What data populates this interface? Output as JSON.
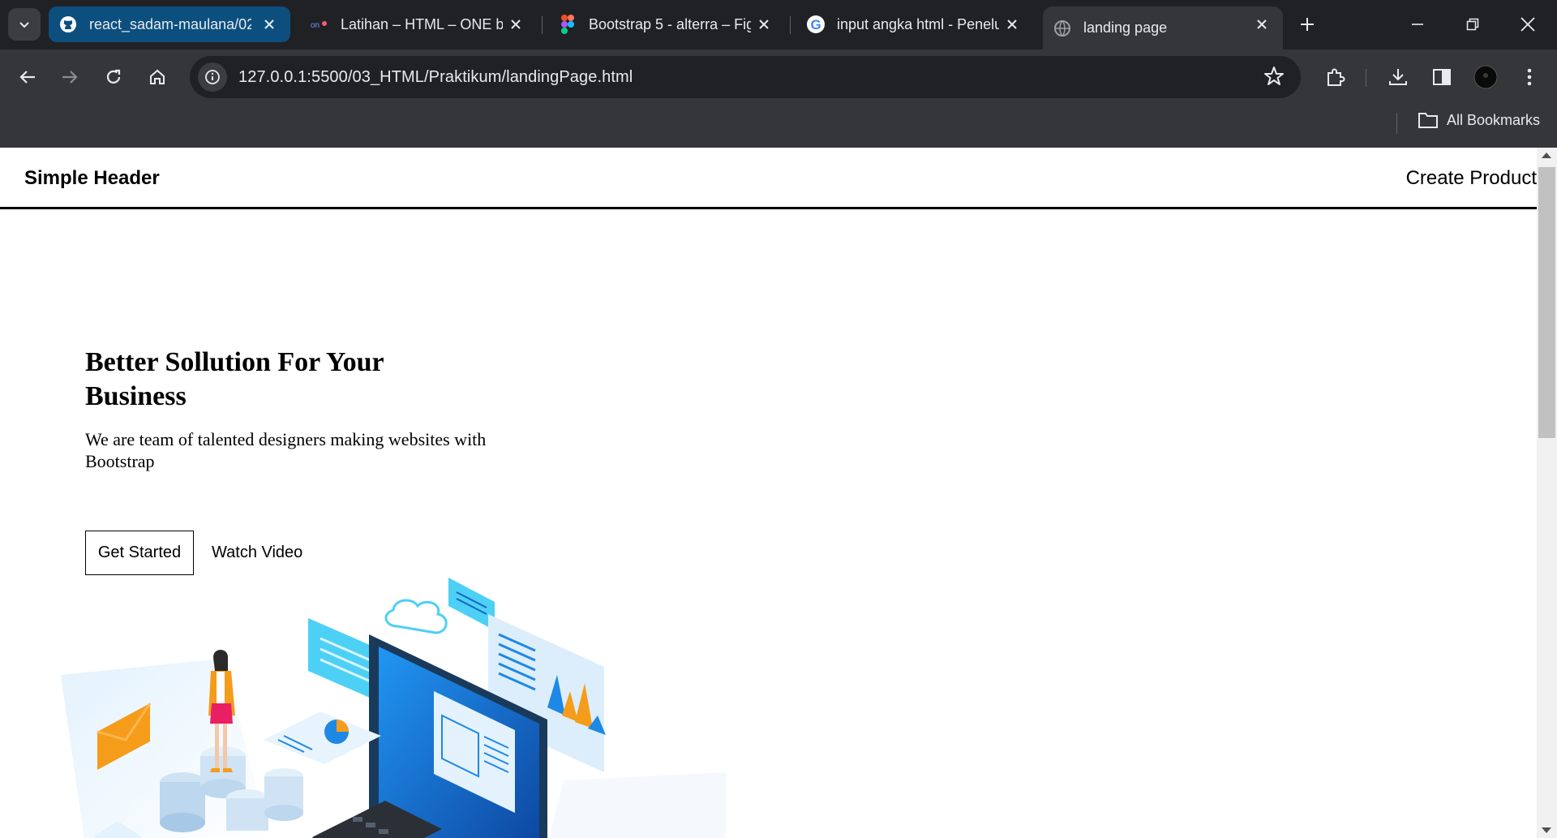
{
  "browser": {
    "tabs": [
      {
        "title": "react_sadam-maulana/02",
        "favicon": "github-icon"
      },
      {
        "title": "Latihan – HTML – ONE by",
        "favicon": "one-logo-icon"
      },
      {
        "title": "Bootstrap 5 - alterra – Fig",
        "favicon": "figma-icon"
      },
      {
        "title": "input angka html - Penelu",
        "favicon": "google-icon"
      },
      {
        "title": "landing page",
        "favicon": "globe-icon"
      }
    ],
    "url": "127.0.0.1:5500/03_HTML/Praktikum/landingPage.html",
    "bookmarks_label": "All Bookmarks"
  },
  "site": {
    "header": {
      "brand": "Simple Header",
      "nav_link": "Create Product"
    },
    "hero": {
      "title": "Better Sollution For Your Business",
      "subtitle": "We are team of talented designers making websites with Bootstrap",
      "primary_button": "Get Started",
      "secondary_link": "Watch Video",
      "illustration": "isometric-business-illustration"
    }
  },
  "colors": {
    "tabstrip": "#202124",
    "toolbar": "#35363a",
    "github_tab": "#0c4f7e",
    "illustration_blue": "#1e88e5",
    "illustration_cyan": "#4dd0f5",
    "illustration_orange": "#f59c1a"
  }
}
